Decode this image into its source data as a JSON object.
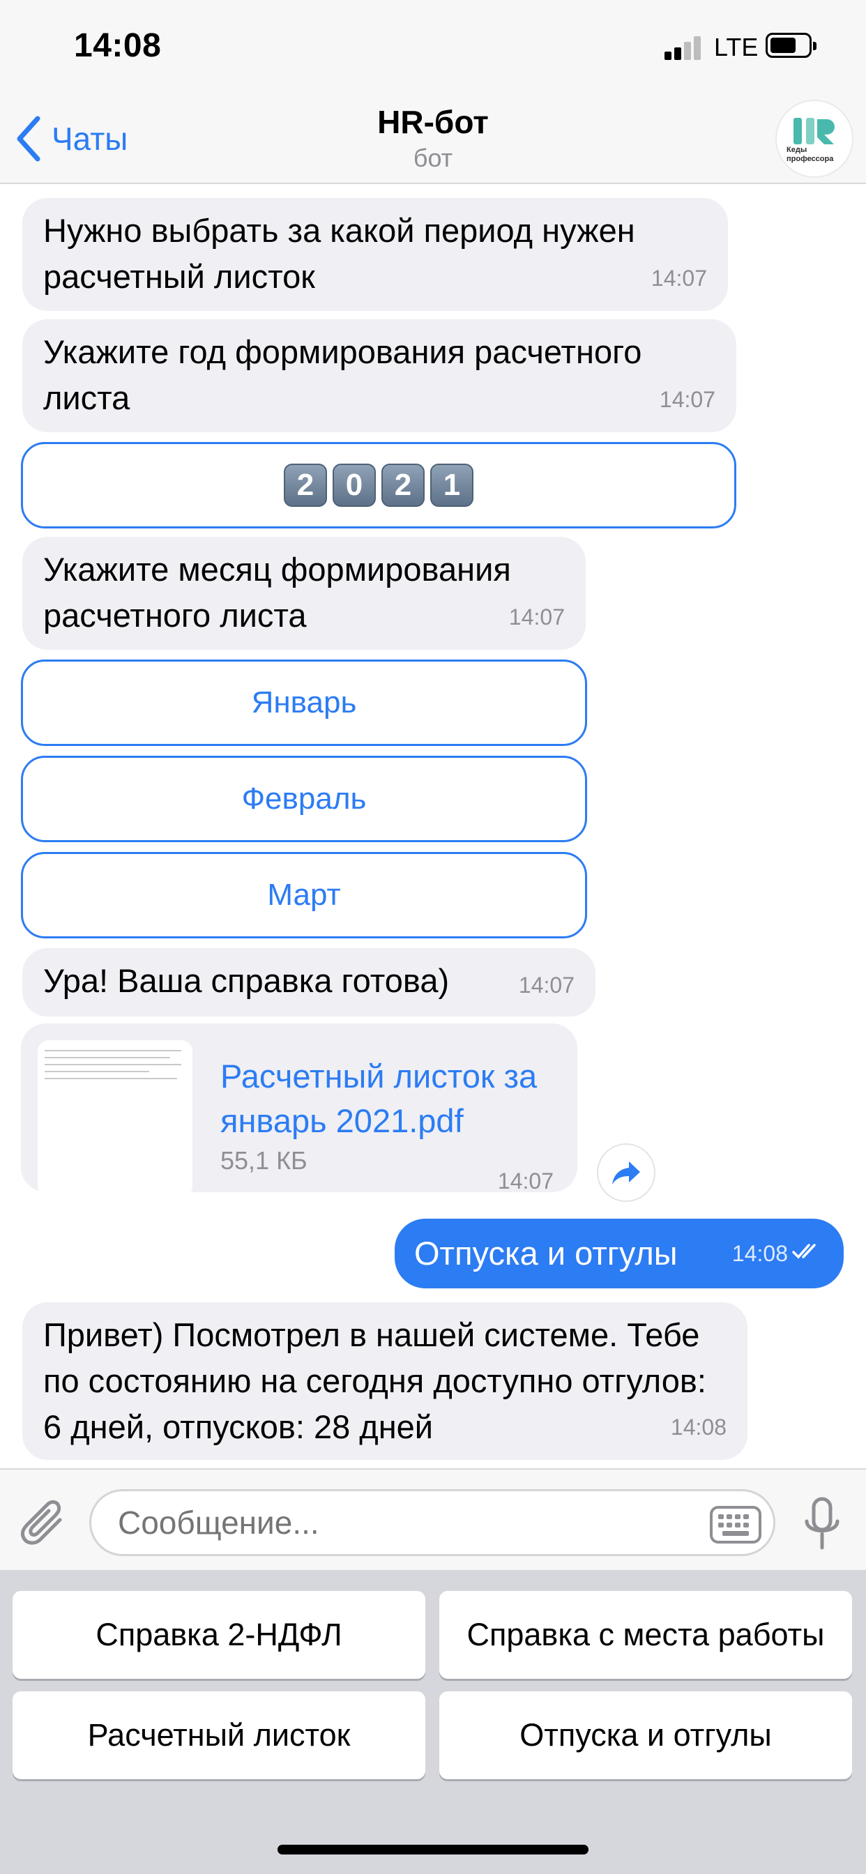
{
  "status_bar": {
    "time": "14:08",
    "network": "LTE"
  },
  "header": {
    "back_label": "Чаты",
    "title": "HR-бот",
    "subtitle": "бот",
    "avatar_text": "Кеды профессора"
  },
  "messages": [
    {
      "text": "Нужно выбрать за какой период нужен расчетный листок",
      "time": "14:07"
    },
    {
      "text": "Укажите год формирования расчетного листа",
      "time": "14:07"
    },
    {
      "text": "Укажите месяц формирования расчетного листа",
      "time": "14:07"
    },
    {
      "text": "Ура! Ваша справка готова)",
      "time": "14:07"
    }
  ],
  "year_button": {
    "digits": [
      "2",
      "0",
      "2",
      "1"
    ]
  },
  "month_buttons": [
    "Январь",
    "Февраль",
    "Март"
  ],
  "file": {
    "name": "Расчетный листок за январь 2021.pdf",
    "size": "55,1 КБ",
    "time": "14:07"
  },
  "outgoing": {
    "text": "Отпуска и отгулы",
    "time": "14:08"
  },
  "reply": {
    "text": "Привет) Посмотрел в нашей системе. Тебе по состоянию на сегодня доступно отгулов: 6 дней, отпусков: 28 дней",
    "time": "14:08"
  },
  "composer": {
    "placeholder": "Сообщение..."
  },
  "keyboard": {
    "buttons": [
      "Справка 2-НДФЛ",
      "Справка с места работы",
      "Расчетный листок",
      "Отпуска и отгулы"
    ]
  },
  "colors": {
    "accent": "#2c7cf3",
    "incoming_bubble": "#efeff4",
    "keyboard_bg": "#d5d7dc"
  },
  "icons": [
    "back-chevron-icon",
    "paperclip-icon",
    "keyboard-icon",
    "microphone-icon",
    "share-icon",
    "double-check-icon"
  ]
}
